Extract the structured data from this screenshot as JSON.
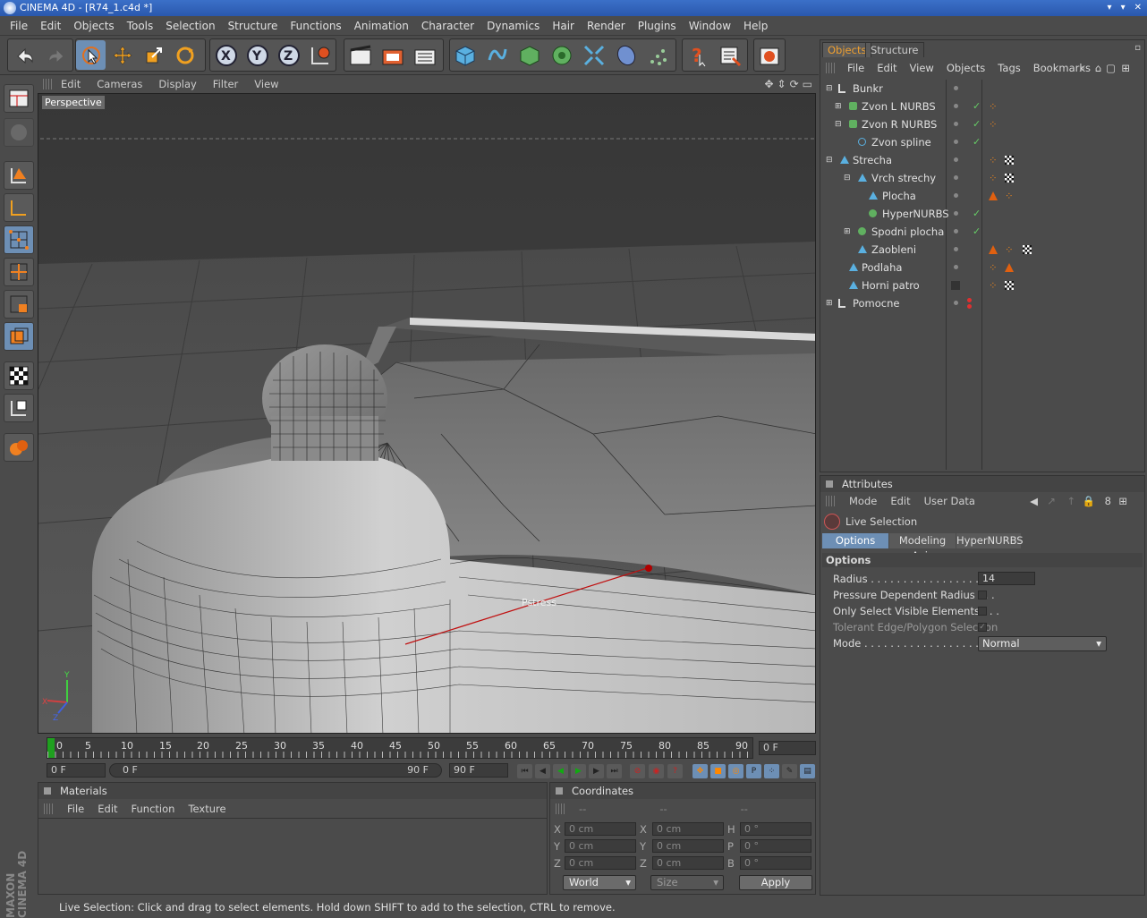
{
  "window": {
    "title": "CINEMA 4D - [R74_1.c4d *]",
    "controls": [
      "▾",
      "▾",
      "✕"
    ]
  },
  "menubar": [
    "File",
    "Edit",
    "Objects",
    "Tools",
    "Selection",
    "Structure",
    "Functions",
    "Animation",
    "Character",
    "Dynamics",
    "Hair",
    "Render",
    "Plugins",
    "Window",
    "Help"
  ],
  "viewport": {
    "menu": [
      "Edit",
      "Cameras",
      "Display",
      "Filter",
      "View"
    ],
    "label": "Perspective",
    "axis_labels": {
      "x": "X",
      "y": "Y",
      "z": "Z"
    },
    "cursor_label": "Pstress"
  },
  "timeline": {
    "ticks": [
      "0",
      "5",
      "10",
      "15",
      "20",
      "25",
      "30",
      "35",
      "40",
      "45",
      "50",
      "55",
      "60",
      "65",
      "70",
      "75",
      "80",
      "85",
      "90"
    ],
    "current_frame": "0 F",
    "start_field": "0 F",
    "range_start": "0 F",
    "range_end": "90 F",
    "end_field": "90 F"
  },
  "materials": {
    "title": "Materials",
    "menu": [
      "File",
      "Edit",
      "Function",
      "Texture"
    ]
  },
  "coordinates": {
    "title": "Coordinates",
    "columns": [
      "--",
      "--",
      "--"
    ],
    "rows": [
      {
        "a": "X",
        "av": "0 cm",
        "b": "X",
        "bv": "0 cm",
        "c": "H",
        "cv": "0 °"
      },
      {
        "a": "Y",
        "av": "0 cm",
        "b": "Y",
        "bv": "0 cm",
        "c": "P",
        "cv": "0 °"
      },
      {
        "a": "Z",
        "av": "0 cm",
        "b": "Z",
        "bv": "0 cm",
        "c": "B",
        "cv": "0 °"
      }
    ],
    "mode_select": "World",
    "size_select": "Size",
    "apply": "Apply"
  },
  "status": "Live Selection: Click and drag to select elements. Hold down SHIFT to add to the selection, CTRL to remove.",
  "brand": {
    "line1": "MAXON",
    "line2": "CINEMA 4D"
  },
  "objects": {
    "tabs": [
      "Objects",
      "Structure"
    ],
    "menu": [
      "File",
      "Edit",
      "View",
      "Objects",
      "Tags",
      "Bookmarks"
    ],
    "items": [
      {
        "name": "Bunkr"
      },
      {
        "name": "Zvon  L NURBS"
      },
      {
        "name": "Zvon  R NURBS"
      },
      {
        "name": "Zvon spline"
      },
      {
        "name": "Strecha"
      },
      {
        "name": "Vrch strechy"
      },
      {
        "name": "Plocha"
      },
      {
        "name": "HyperNURBS"
      },
      {
        "name": "Spodni plocha"
      },
      {
        "name": "Zaobleni"
      },
      {
        "name": "Podlaha"
      },
      {
        "name": "Horni patro"
      },
      {
        "name": "Pomocne"
      }
    ]
  },
  "attributes": {
    "title": "Attributes",
    "menu": [
      "Mode",
      "Edit",
      "User Data"
    ],
    "tool": "Live Selection",
    "tabs": [
      "Options",
      "Modeling Axis",
      "HyperNURBS"
    ],
    "section": "Options",
    "fields": {
      "radius_label": "Radius . . . . . . . . . . . . . . . . . . .",
      "radius_value": "14",
      "pressure_label": "Pressure Dependent Radius . . .",
      "visible_label": "Only Select Visible Elements . . .",
      "tolerant_label": "Tolerant Edge/Polygon Selection",
      "mode_label": "Mode . . . . . . . . . . . . . . . . . . . .",
      "mode_value": "Normal"
    }
  },
  "colors": {
    "accent": "#6d8fb5",
    "title_bar": "#2a58ad",
    "tab_active": "#e89a2a"
  }
}
